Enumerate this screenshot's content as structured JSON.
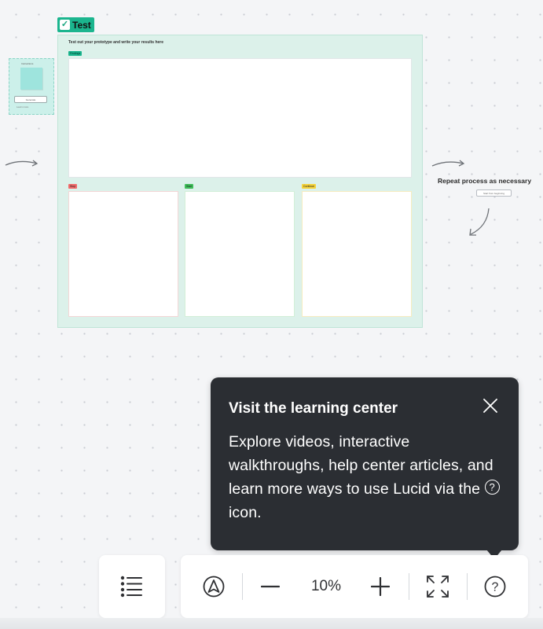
{
  "canvas": {
    "frame": {
      "tab_label": "Test",
      "instructions": "Test out your prototype and write your results here",
      "sections": [
        {
          "label": "Findings",
          "color": "#1bb58e"
        },
        {
          "label": "Stop",
          "color": "#f26b6b"
        },
        {
          "label": "Start",
          "color": "#3fbf5a"
        },
        {
          "label": "Continue",
          "color": "#f5d33b"
        }
      ]
    },
    "side_card": {
      "title": "Instructions",
      "button_label": "Generate",
      "sub_label": "Learn more"
    },
    "repeat_text": "Repeat process as necessary",
    "repeat_button": "Start from beginning"
  },
  "tooltip": {
    "title": "Visit the learning center",
    "body_main": "Explore videos, interactive walkthroughs, help center articles, and learn more ways to use Lucid via the",
    "body_end": "icon.",
    "inline_icon": "help-icon",
    "close_icon": "close-icon"
  },
  "toolbar": {
    "outline_icon": "list-icon",
    "navigate_icon": "navigation-icon",
    "zoom_out_icon": "minus-icon",
    "zoom_level": "10%",
    "zoom_in_icon": "plus-icon",
    "fit_icon": "expand-icon",
    "help_icon": "help-icon"
  }
}
